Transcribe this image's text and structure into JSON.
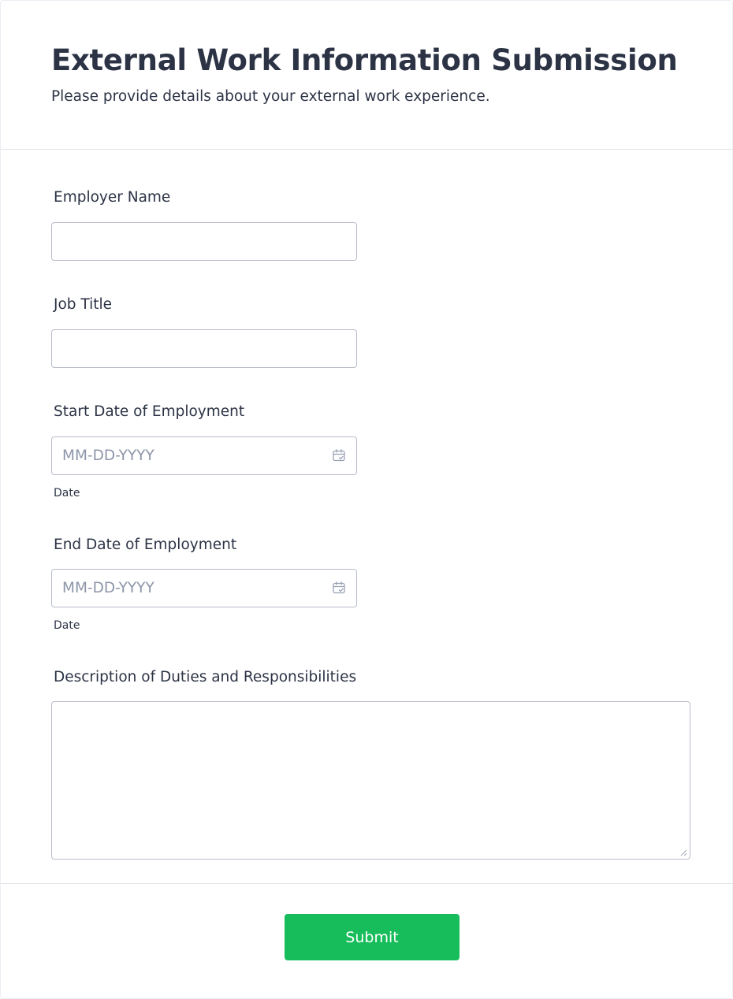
{
  "header": {
    "title": "External Work Information Submission",
    "subtitle": "Please provide details about your external work experience."
  },
  "fields": {
    "employer_name": {
      "label": "Employer Name",
      "value": ""
    },
    "job_title": {
      "label": "Job Title",
      "value": ""
    },
    "start_date": {
      "label": "Start Date of Employment",
      "placeholder": "MM-DD-YYYY",
      "sublabel": "Date",
      "icon": "calendar-icon"
    },
    "end_date": {
      "label": "End Date of Employment",
      "placeholder": "MM-DD-YYYY",
      "sublabel": "Date",
      "icon": "calendar-icon"
    },
    "description": {
      "label": "Description of Duties and Responsibilities",
      "value": ""
    }
  },
  "footer": {
    "submit_label": "Submit"
  },
  "colors": {
    "text": "#2c3345",
    "placeholder": "#8d95a8",
    "border": "#b8bdc9",
    "submit": "#18bd5b"
  }
}
